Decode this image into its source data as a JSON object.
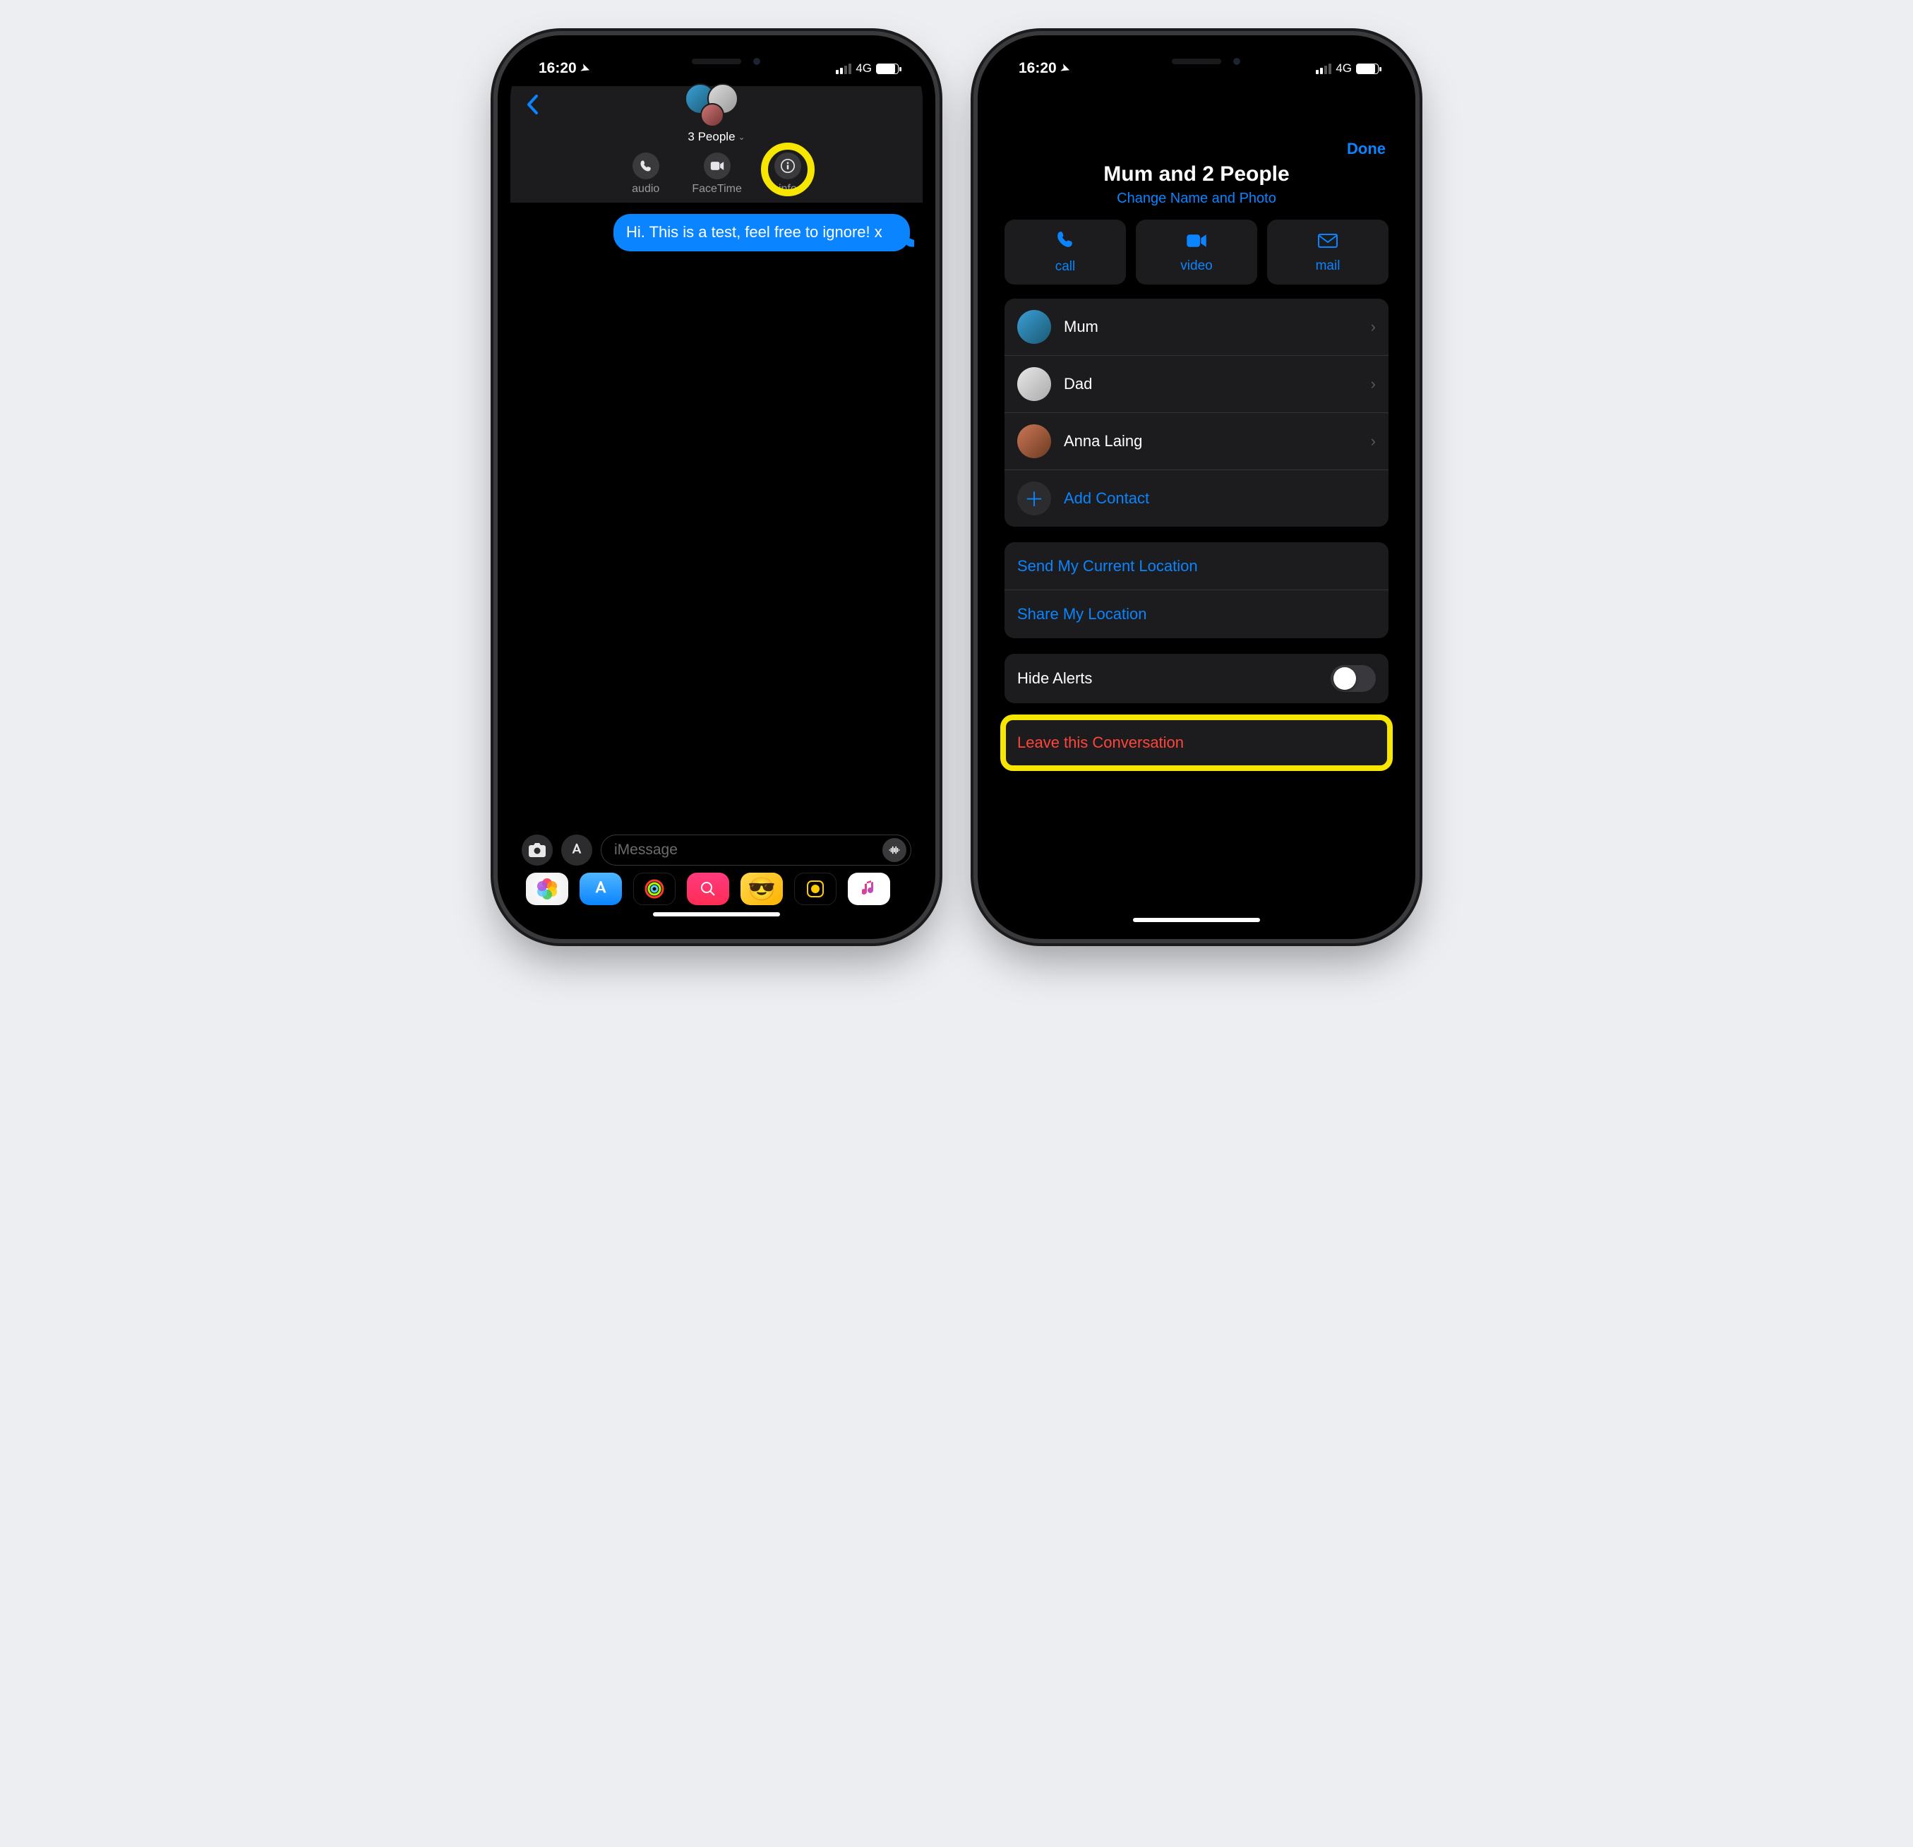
{
  "status": {
    "time": "16:20",
    "network": "4G"
  },
  "phone1": {
    "header": {
      "subtitle": "3 People",
      "actions": {
        "audio": "audio",
        "facetime": "FaceTime",
        "info": "info"
      }
    },
    "message": "Hi. This is a test, feel free to ignore! x",
    "composer": {
      "placeholder": "iMessage"
    }
  },
  "phone2": {
    "done": "Done",
    "title": "Mum and 2 People",
    "change": "Change Name and Photo",
    "actions": {
      "call": "call",
      "video": "video",
      "mail": "mail"
    },
    "members": [
      {
        "name": "Mum"
      },
      {
        "name": "Dad"
      },
      {
        "name": "Anna Laing"
      }
    ],
    "add_contact": "Add Contact",
    "send_location": "Send My Current Location",
    "share_location": "Share My Location",
    "hide_alerts": "Hide Alerts",
    "leave": "Leave this Conversation"
  }
}
